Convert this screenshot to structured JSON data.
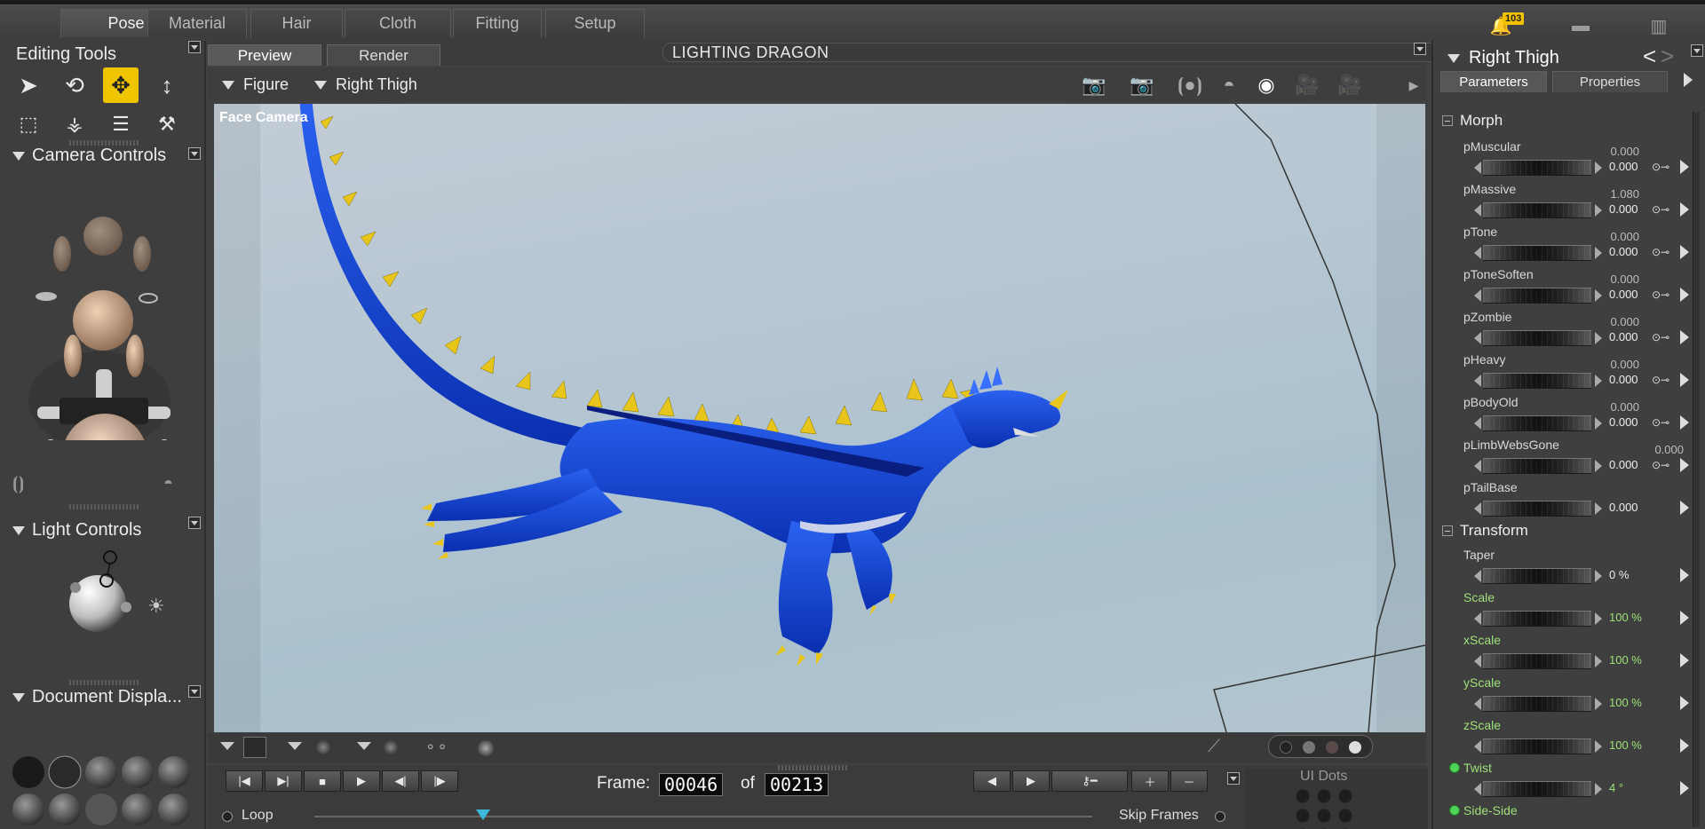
{
  "rooms": [
    "Pose",
    "Material",
    "Hair",
    "Cloth",
    "Fitting",
    "Setup"
  ],
  "notifications": {
    "count": "103"
  },
  "left_panel": {
    "editing_tools": {
      "title": "Editing Tools"
    },
    "camera_controls": {
      "title": "Camera Controls"
    },
    "light_controls": {
      "title": "Light Controls"
    },
    "document_display": {
      "title": "Document  Displa..."
    }
  },
  "viewport": {
    "tabs": [
      "Preview",
      "Render"
    ],
    "scene_title": "LIGHTING DRAGON",
    "figure_dropdown": "Figure",
    "actor_dropdown": "Right Thigh",
    "camera_name": "Face Camera"
  },
  "animation": {
    "frame_label": "Frame:",
    "current_frame": "00046",
    "of_label": "of",
    "total_frames": "00213",
    "loop_label": "Loop",
    "skip_frames_label": "Skip Frames",
    "ui_dots_label": "UI Dots"
  },
  "right_panel": {
    "actor": "Right Thigh",
    "tabs": [
      "Parameters",
      "Properties"
    ],
    "morph_section": "Morph",
    "transform_section": "Transform",
    "morph_params": [
      {
        "name": "pMuscular",
        "default": "0.000",
        "value": "0.000"
      },
      {
        "name": "pMassive",
        "default": "1.080",
        "value": "0.000"
      },
      {
        "name": "pTone",
        "default": "0.000",
        "value": "0.000"
      },
      {
        "name": "pToneSoften",
        "default": "0.000",
        "value": "0.000"
      },
      {
        "name": "pZombie",
        "default": "0.000",
        "value": "0.000"
      },
      {
        "name": "pHeavy",
        "default": "0.000",
        "value": "0.000"
      },
      {
        "name": "pBodyOld",
        "default": "0.000",
        "value": "0.000"
      },
      {
        "name": "pLimbWebsGone",
        "default": "0.000",
        "value": "0.000"
      },
      {
        "name": "pTailBase",
        "default": "",
        "value": "0.000"
      }
    ],
    "transform_params": [
      {
        "name": "Taper",
        "value": "0 %"
      },
      {
        "name": "Scale",
        "value": "100 %"
      },
      {
        "name": "xScale",
        "value": "100 %"
      },
      {
        "name": "yScale",
        "value": "100 %"
      },
      {
        "name": "zScale",
        "value": "100 %"
      },
      {
        "name": "Twist",
        "value": "4 °"
      },
      {
        "name": "Side-Side",
        "value": ""
      }
    ]
  },
  "colors": {
    "accent": "#f0c400",
    "green_param": "#9fe07a",
    "dragon": "#1a4fd6"
  }
}
